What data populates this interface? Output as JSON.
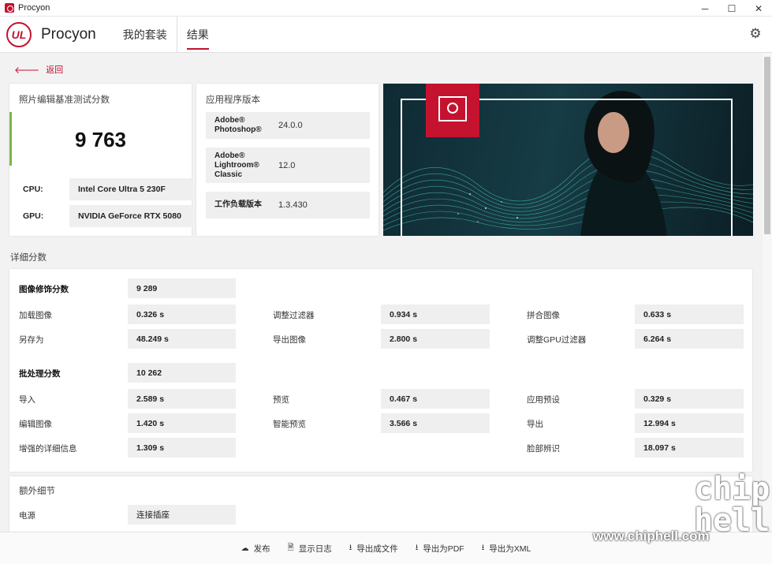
{
  "window": {
    "title": "Procyon",
    "minimize": "─",
    "maximize": "☐",
    "close": "✕"
  },
  "header": {
    "brand": "Procyon",
    "logo_text": "UL",
    "tabs": [
      {
        "label": "我的套装"
      },
      {
        "label": "结果"
      }
    ]
  },
  "back": {
    "label": "返回"
  },
  "score_card": {
    "title": "照片编辑基准测试分数",
    "score": "9 763",
    "cpu_label": "CPU:",
    "cpu_value": "Intel Core Ultra 5 230F",
    "gpu_label": "GPU:",
    "gpu_value": "NVIDIA GeForce RTX 5080"
  },
  "app_card": {
    "title": "应用程序版本",
    "rows": [
      {
        "name": "Adobe® Photoshop®",
        "version": "24.0.0"
      },
      {
        "name": "Adobe® Lightroom® Classic",
        "version": "12.0"
      },
      {
        "name": "工作负载版本",
        "version": "1.3.430"
      }
    ]
  },
  "details": {
    "section_title": "详细分数",
    "retouch": {
      "label": "图像修饰分数",
      "value": "9 289",
      "items": [
        {
          "label": "加载图像",
          "value": "0.326 s"
        },
        {
          "label": "调整过滤器",
          "value": "0.934 s"
        },
        {
          "label": "拼合图像",
          "value": "0.633 s"
        },
        {
          "label": "另存为",
          "value": "48.249 s"
        },
        {
          "label": "导出图像",
          "value": "2.800 s"
        },
        {
          "label": "调整GPU过滤器",
          "value": "6.264 s"
        }
      ]
    },
    "batch": {
      "label": "批处理分数",
      "value": "10 262",
      "items": [
        {
          "label": "导入",
          "value": "2.589 s"
        },
        {
          "label": "预览",
          "value": "0.467 s"
        },
        {
          "label": "应用预设",
          "value": "0.329 s"
        },
        {
          "label": "编辑图像",
          "value": "1.420 s"
        },
        {
          "label": "智能预览",
          "value": "3.566 s"
        },
        {
          "label": "导出",
          "value": "12.994 s"
        },
        {
          "label": "增强的详细信息",
          "value": "1.309 s"
        },
        {
          "label": "脸部辨识",
          "value": "18.097 s"
        }
      ]
    }
  },
  "extra": {
    "title": "额外细节",
    "power_label": "电源",
    "power_value": "连接插座"
  },
  "footer": {
    "publish": "发布",
    "show_log": "显示日志",
    "export_file": "导出成文件",
    "export_pdf": "导出为PDF",
    "export_xml": "导出为XML"
  },
  "watermark": {
    "site": "www.chiphell.com",
    "logo": "chip hell"
  },
  "colors": {
    "accent": "#c4122f",
    "score_bar": "#7ab648"
  }
}
